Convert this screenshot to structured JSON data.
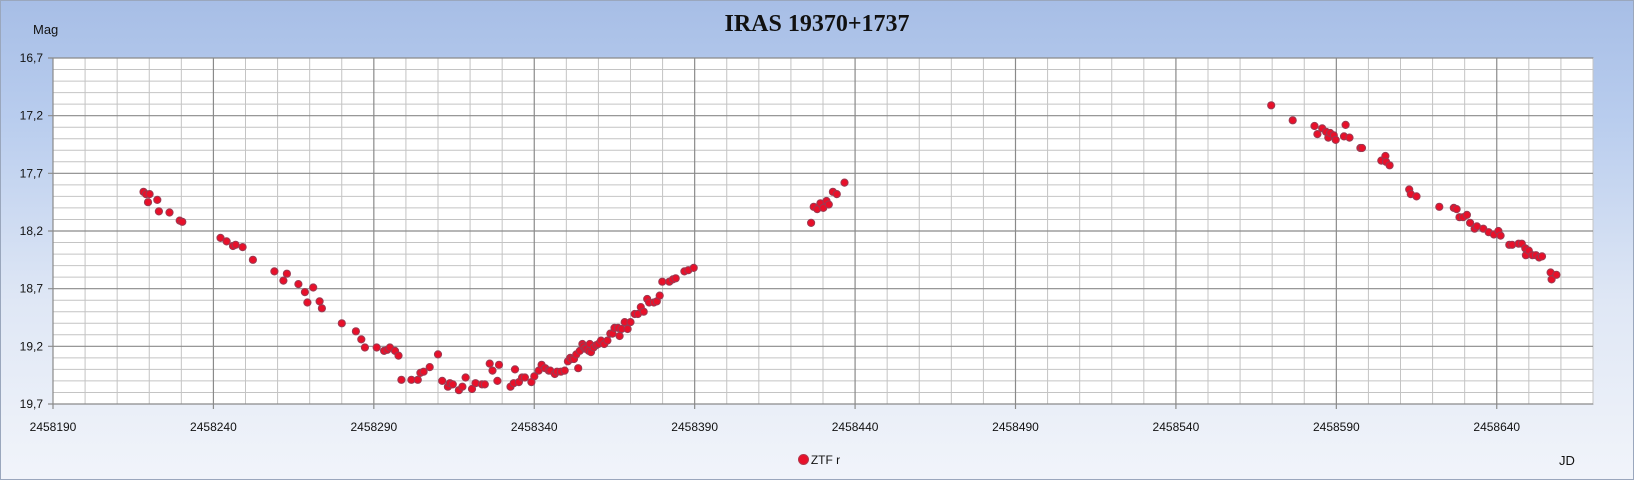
{
  "chart_data": {
    "type": "scatter",
    "title": "IRAS 19370+1737",
    "ylabel": "Mag",
    "xlabel": "JD",
    "y_inverted": true,
    "xlim": [
      2458190,
      2458670
    ],
    "ylim": [
      16.7,
      19.7
    ],
    "x_ticks": [
      2458190,
      2458240,
      2458290,
      2458340,
      2458390,
      2458440,
      2458490,
      2458540,
      2458590,
      2458640
    ],
    "y_ticks": [
      "16,7",
      "17,2",
      "17,7",
      "18,2",
      "18,7",
      "19,2",
      "19,7"
    ],
    "grid": true,
    "legend_position": "bottom-center",
    "series": [
      {
        "name": "ZTF r",
        "color": "#e8102a",
        "points": [
          [
            2458218.2,
            17.86
          ],
          [
            2458219.0,
            17.88
          ],
          [
            2458219.6,
            17.95
          ],
          [
            2458220.1,
            17.88
          ],
          [
            2458222.5,
            17.93
          ],
          [
            2458223.0,
            18.03
          ],
          [
            2458226.3,
            18.04
          ],
          [
            2458229.5,
            18.11
          ],
          [
            2458230.3,
            18.12
          ],
          [
            2458242.2,
            18.26
          ],
          [
            2458244.1,
            18.29
          ],
          [
            2458246.1,
            18.33
          ],
          [
            2458246.9,
            18.32
          ],
          [
            2458249.1,
            18.34
          ],
          [
            2458252.3,
            18.45
          ],
          [
            2458259.0,
            18.55
          ],
          [
            2458261.8,
            18.63
          ],
          [
            2458262.9,
            18.57
          ],
          [
            2458266.5,
            18.66
          ],
          [
            2458268.5,
            18.73
          ],
          [
            2458269.3,
            18.82
          ],
          [
            2458271.1,
            18.69
          ],
          [
            2458273.1,
            18.81
          ],
          [
            2458273.8,
            18.87
          ],
          [
            2458280.0,
            19.0
          ],
          [
            2458284.4,
            19.07
          ],
          [
            2458286.1,
            19.14
          ],
          [
            2458287.2,
            19.21
          ],
          [
            2458290.9,
            19.21
          ],
          [
            2458293.2,
            19.24
          ],
          [
            2458294.2,
            19.23
          ],
          [
            2458295.0,
            19.21
          ],
          [
            2458296.6,
            19.24
          ],
          [
            2458297.7,
            19.28
          ],
          [
            2458298.6,
            19.49
          ],
          [
            2458301.7,
            19.49
          ],
          [
            2458303.7,
            19.49
          ],
          [
            2458304.5,
            19.43
          ],
          [
            2458305.5,
            19.42
          ],
          [
            2458307.4,
            19.38
          ],
          [
            2458310.0,
            19.27
          ],
          [
            2458311.3,
            19.5
          ],
          [
            2458313.1,
            19.55
          ],
          [
            2458313.7,
            19.52
          ],
          [
            2458314.6,
            19.53
          ],
          [
            2458316.5,
            19.58
          ],
          [
            2458317.6,
            19.55
          ],
          [
            2458318.6,
            19.47
          ],
          [
            2458320.6,
            19.57
          ],
          [
            2458321.7,
            19.52
          ],
          [
            2458323.7,
            19.53
          ],
          [
            2458324.6,
            19.53
          ],
          [
            2458326.1,
            19.35
          ],
          [
            2458327.0,
            19.41
          ],
          [
            2458328.5,
            19.5
          ],
          [
            2458329.0,
            19.36
          ],
          [
            2458332.6,
            19.55
          ],
          [
            2458333.6,
            19.52
          ],
          [
            2458334.0,
            19.4
          ],
          [
            2458335.2,
            19.51
          ],
          [
            2458336.2,
            19.47
          ],
          [
            2458337.1,
            19.47
          ],
          [
            2458339.1,
            19.51
          ],
          [
            2458340.0,
            19.46
          ],
          [
            2458341.4,
            19.41
          ],
          [
            2458342.3,
            19.36
          ],
          [
            2458343.4,
            19.39
          ],
          [
            2458344.5,
            19.41
          ],
          [
            2458345.0,
            19.41
          ],
          [
            2458346.4,
            19.44
          ],
          [
            2458347.1,
            19.42
          ],
          [
            2458348.3,
            19.42
          ],
          [
            2458349.5,
            19.41
          ],
          [
            2458350.5,
            19.33
          ],
          [
            2458351.2,
            19.3
          ],
          [
            2458351.6,
            19.31
          ],
          [
            2458352.4,
            19.31
          ],
          [
            2458353.1,
            19.27
          ],
          [
            2458353.7,
            19.39
          ],
          [
            2458354.2,
            19.24
          ],
          [
            2458355.0,
            19.18
          ],
          [
            2458355.3,
            19.2
          ],
          [
            2458355.8,
            19.22
          ],
          [
            2458356.3,
            19.22
          ],
          [
            2458357.0,
            19.24
          ],
          [
            2458357.3,
            19.18
          ],
          [
            2458357.7,
            19.25
          ],
          [
            2458358.5,
            19.21
          ],
          [
            2458359.3,
            19.19
          ],
          [
            2458360.0,
            19.18
          ],
          [
            2458360.8,
            19.15
          ],
          [
            2458361.8,
            19.18
          ],
          [
            2458362.8,
            19.15
          ],
          [
            2458363.7,
            19.09
          ],
          [
            2458364.4,
            19.09
          ],
          [
            2458365.0,
            19.04
          ],
          [
            2458366.1,
            19.04
          ],
          [
            2458366.6,
            19.11
          ],
          [
            2458367.2,
            19.05
          ],
          [
            2458368.2,
            18.99
          ],
          [
            2458369.1,
            19.05
          ],
          [
            2458370.0,
            18.99
          ],
          [
            2458371.3,
            18.92
          ],
          [
            2458372.3,
            18.92
          ],
          [
            2458373.2,
            18.86
          ],
          [
            2458374.1,
            18.9
          ],
          [
            2458375.2,
            18.79
          ],
          [
            2458375.8,
            18.82
          ],
          [
            2458377.3,
            18.82
          ],
          [
            2458378.2,
            18.81
          ],
          [
            2458379.1,
            18.76
          ],
          [
            2458379.9,
            18.64
          ],
          [
            2458382.1,
            18.64
          ],
          [
            2458383.2,
            18.62
          ],
          [
            2458384.1,
            18.61
          ],
          [
            2458386.8,
            18.55
          ],
          [
            2458388.0,
            18.54
          ],
          [
            2458389.7,
            18.52
          ],
          [
            2458426.3,
            18.13
          ],
          [
            2458427.1,
            17.99
          ],
          [
            2458428.2,
            18.01
          ],
          [
            2458429.2,
            17.96
          ],
          [
            2458430.1,
            18.0
          ],
          [
            2458431.1,
            17.94
          ],
          [
            2458431.8,
            17.97
          ],
          [
            2458433.1,
            17.86
          ],
          [
            2458434.3,
            17.88
          ],
          [
            2458436.7,
            17.78
          ],
          [
            2458569.7,
            17.11
          ],
          [
            2458576.4,
            17.24
          ],
          [
            2458583.2,
            17.29
          ],
          [
            2458584.1,
            17.36
          ],
          [
            2458585.6,
            17.31
          ],
          [
            2458586.8,
            17.34
          ],
          [
            2458587.5,
            17.39
          ],
          [
            2458588.1,
            17.35
          ],
          [
            2458589.2,
            17.37
          ],
          [
            2458589.8,
            17.41
          ],
          [
            2458592.4,
            17.38
          ],
          [
            2458592.9,
            17.28
          ],
          [
            2458594.1,
            17.39
          ],
          [
            2458597.5,
            17.48
          ],
          [
            2458598.0,
            17.48
          ],
          [
            2458604.0,
            17.59
          ],
          [
            2458605.3,
            17.55
          ],
          [
            2458605.5,
            17.6
          ],
          [
            2458606.6,
            17.63
          ],
          [
            2458612.7,
            17.84
          ],
          [
            2458613.2,
            17.88
          ],
          [
            2458615.0,
            17.9
          ],
          [
            2458622.1,
            17.99
          ],
          [
            2458626.6,
            18.0
          ],
          [
            2458627.5,
            18.01
          ],
          [
            2458628.4,
            18.08
          ],
          [
            2458629.5,
            18.08
          ],
          [
            2458630.7,
            18.06
          ],
          [
            2458631.7,
            18.13
          ],
          [
            2458633.1,
            18.18
          ],
          [
            2458633.8,
            18.16
          ],
          [
            2458635.8,
            18.18
          ],
          [
            2458637.5,
            18.21
          ],
          [
            2458639.1,
            18.23
          ],
          [
            2458640.5,
            18.2
          ],
          [
            2458641.2,
            18.24
          ],
          [
            2458643.9,
            18.32
          ],
          [
            2458644.8,
            18.32
          ],
          [
            2458646.8,
            18.31
          ],
          [
            2458647.8,
            18.31
          ],
          [
            2458648.9,
            18.35
          ],
          [
            2458649.1,
            18.41
          ],
          [
            2458650.0,
            18.37
          ],
          [
            2458651.1,
            18.41
          ],
          [
            2458652.2,
            18.41
          ],
          [
            2458653.2,
            18.43
          ],
          [
            2458654.1,
            18.42
          ],
          [
            2458656.8,
            18.56
          ],
          [
            2458657.1,
            18.62
          ],
          [
            2458658.6,
            18.58
          ]
        ]
      }
    ]
  }
}
